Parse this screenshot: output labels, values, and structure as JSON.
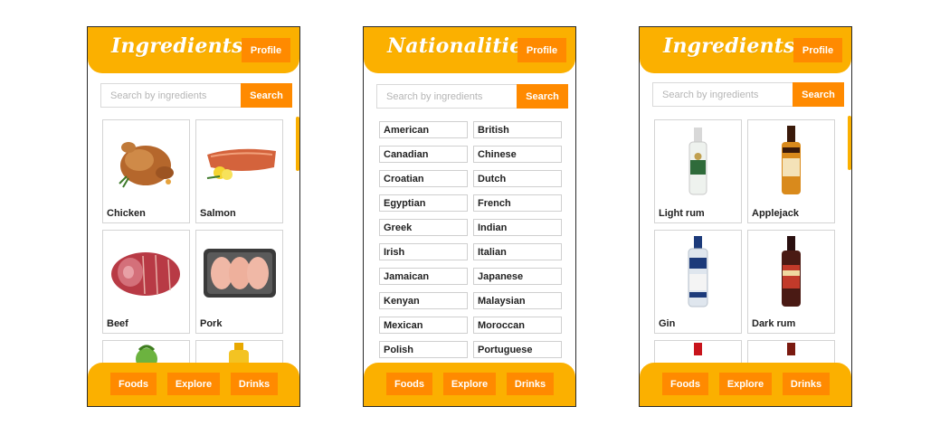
{
  "screens": [
    {
      "brand": "Ingredients",
      "profile_label": "Profile",
      "search": {
        "placeholder": "Search by ingredients",
        "button": "Search"
      },
      "items": [
        "Chicken",
        "Salmon",
        "Beef",
        "Pork"
      ],
      "nav": {
        "foods": "Foods",
        "explore": "Explore",
        "drinks": "Drinks"
      }
    },
    {
      "brand": "Nationalities",
      "profile_label": "Profile",
      "search": {
        "placeholder": "Search by ingredients",
        "button": "Search"
      },
      "nationalities": [
        "American",
        "British",
        "Canadian",
        "Chinese",
        "Croatian",
        "Dutch",
        "Egyptian",
        "French",
        "Greek",
        "Indian",
        "Irish",
        "Italian",
        "Jamaican",
        "Japanese",
        "Kenyan",
        "Malaysian",
        "Mexican",
        "Moroccan",
        "Polish",
        "Portuguese"
      ],
      "nav": {
        "foods": "Foods",
        "explore": "Explore",
        "drinks": "Drinks"
      }
    },
    {
      "brand": "Ingredients",
      "profile_label": "Profile",
      "search": {
        "placeholder": "Search by ingredients",
        "button": "Search"
      },
      "items": [
        "Light rum",
        "Applejack",
        "Gin",
        "Dark rum"
      ],
      "nav": {
        "foods": "Foods",
        "explore": "Explore",
        "drinks": "Drinks"
      }
    }
  ],
  "colors": {
    "header": "#fbb000",
    "button": "#ff8a00"
  }
}
